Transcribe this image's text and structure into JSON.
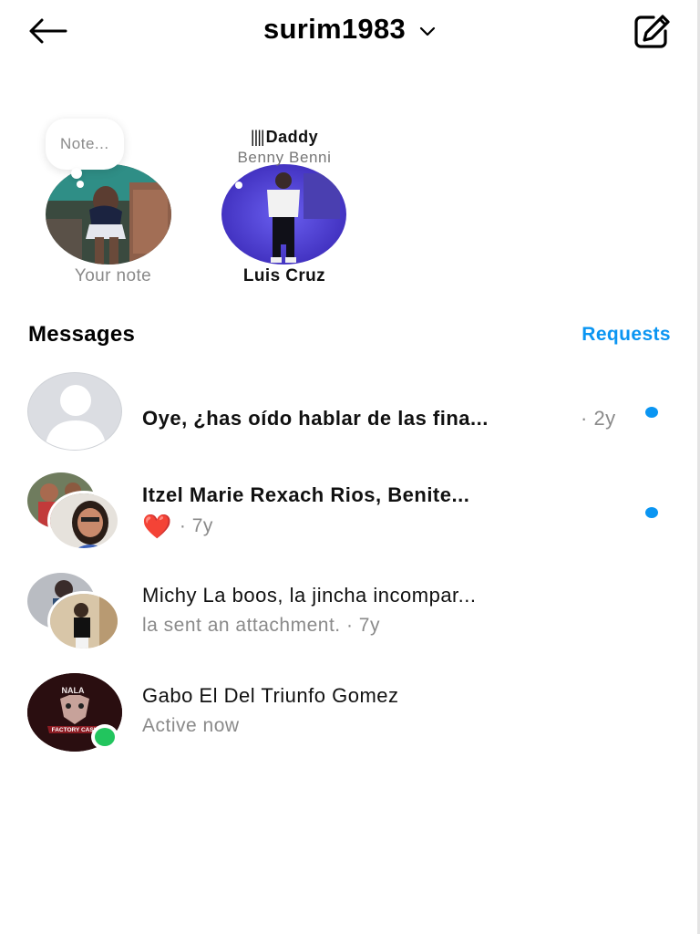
{
  "header": {
    "title": "surim1983",
    "back_icon": "arrow-left-icon",
    "dropdown_icon": "chevron-down-icon",
    "compose_icon": "compose-edit-icon"
  },
  "notes": {
    "own": {
      "bubble_text": "Note...",
      "caption": "Your note"
    },
    "friend": {
      "note_line1": "Daddy",
      "note_line2": "Benny Benni",
      "caption": "Luis Cruz"
    }
  },
  "messages_section": {
    "title": "Messages",
    "requests_label": "Requests"
  },
  "threads": [
    {
      "name": "Oye, ¿has oído hablar de las fina...",
      "time": "· 2y",
      "unread": true
    },
    {
      "name": "Itzel Marie Rexach Rios, Benite...",
      "sub_icon": "red-heart-emoji",
      "heart": "❤️",
      "sub_time": "· 7y",
      "unread": true
    },
    {
      "name": "Michy La boos, la jincha incompar...",
      "sub": "la sent an attachment. · 7y",
      "unread": false
    },
    {
      "name": "Gabo El Del Triunfo Gomez",
      "sub": "Active now",
      "online": true,
      "logo_text": "NALA",
      "logo_text_2": "FACTORY CASH"
    }
  ],
  "colors": {
    "accent_blue": "#0a95f2",
    "online_green": "#22c55e",
    "muted_text": "#8a8a8a"
  }
}
